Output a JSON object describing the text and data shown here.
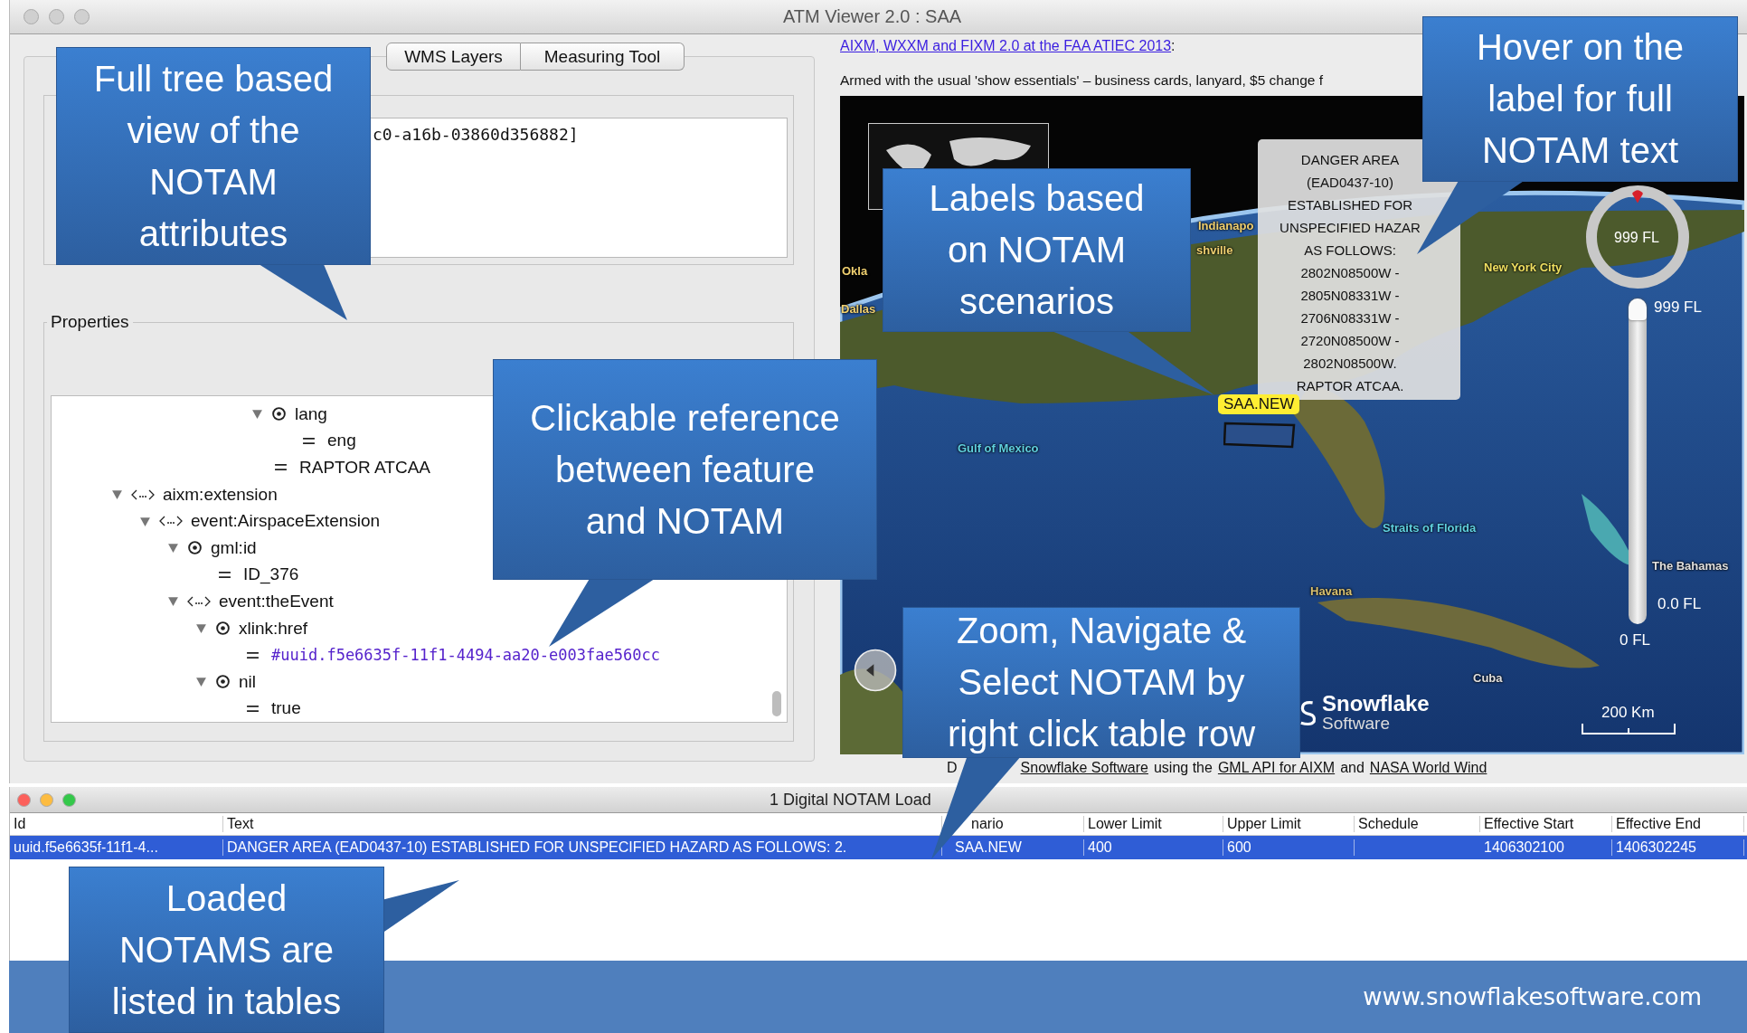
{
  "window": {
    "title": "ATM Viewer 2.0 : SAA",
    "active": false
  },
  "tabs": [
    {
      "label": "WMS Layers",
      "selected": false
    },
    {
      "label": "Measuring Tool",
      "selected": false
    }
  ],
  "identifier_field": {
    "value": "c0-a16b-03860d356882]"
  },
  "properties": {
    "title": "Properties"
  },
  "tree": [
    {
      "children": [
        {
          "children": [
            {
              "children": [
                {
                  "children": [
                    {
                      "children": [
                        {
                          "kind": "attribute",
                          "label": "lang",
                          "expanded": true,
                          "children": [
                            {
                              "kind": "value",
                              "label": "eng"
                            }
                          ]
                        },
                        {
                          "kind": "value",
                          "label": "RAPTOR ATCAA"
                        }
                      ]
                    }
                  ]
                }
              ]
            }
          ]
        }
      ]
    },
    {
      "kind": "element",
      "label": "aixm:extension",
      "expanded": true,
      "children": [
        {
          "kind": "element",
          "label": "event:AirspaceExtension",
          "expanded": true,
          "children": [
            {
              "kind": "attribute",
              "label": "gml:id",
              "expanded": true,
              "children": [
                {
                  "kind": "value",
                  "label": "ID_376"
                }
              ]
            },
            {
              "kind": "element",
              "label": "event:theEvent",
              "expanded": true,
              "children": [
                {
                  "kind": "attribute",
                  "label": "xlink:href",
                  "expanded": true,
                  "children": [
                    {
                      "kind": "link",
                      "label": "#uuid.f5e6635f-11f1-4494-aa20-e003fae560cc"
                    }
                  ]
                },
                {
                  "kind": "attribute",
                  "label": "nil",
                  "expanded": true,
                  "children": [
                    {
                      "kind": "value",
                      "label": "true"
                    }
                  ]
                }
              ]
            }
          ]
        }
      ]
    }
  ],
  "article": {
    "link": "AIXM, WXXM and FIXM 2.0 at the FAA ATIEC 2013",
    "link_suffix": ":",
    "intro": "Armed with the usual 'show essentials' – business cards, lanyard, $5 change f"
  },
  "map": {
    "place_labels": [
      "Indianapo",
      "shville",
      "Okla",
      "Dallas",
      "New York City",
      "Gulf of Mexico",
      "Straits of Florida",
      "Havana",
      "Cuba",
      "The Bahamas"
    ],
    "tooltip_lines": [
      "DANGER AREA",
      "(EAD0437-10)",
      "ESTABLISHED FOR",
      "UNSPECIFIED HAZAR",
      "AS FOLLOWS:",
      "2802N08500W -",
      "2805N08331W -",
      "2706N08331W -",
      "2720N08500W -",
      "2802N08500W.",
      "RAPTOR ATCAA."
    ],
    "feature_label": "SAA.NEW",
    "compass_reading": "999 FL",
    "altitude_slider": {
      "level": 1,
      "top_reading": "999 FL",
      "bottom_reading": "0.0 FL",
      "min_label": "0 FL"
    },
    "scale": "200 Km",
    "logo": {
      "name": "Snowflake",
      "sub": "Software"
    }
  },
  "caption": [
    {
      "kind": "text",
      "text": "D"
    },
    {
      "kind": "link",
      "text": "Snowflake Software"
    },
    {
      "kind": "text",
      "text": "using the"
    },
    {
      "kind": "link",
      "text": "GML API for AIXM"
    },
    {
      "kind": "text",
      "text": "and"
    },
    {
      "kind": "link",
      "text": "NASA World Wind"
    }
  ],
  "notam_window": {
    "title": "1 Digital NOTAM Load",
    "active": true
  },
  "table": {
    "columns": [
      "Id",
      "Text",
      "nario",
      "Lower Limit",
      "Upper Limit",
      "Schedule",
      "Effective Start",
      "Effective End"
    ],
    "rows": [
      {
        "selected": true,
        "cells": [
          "uuid.f5e6635f-11f1-4...",
          "DANGER AREA (EAD0437-10) ESTABLISHED FOR UNSPECIFIED HAZARD AS FOLLOWS: 2.",
          "SAA.NEW",
          "400",
          "600",
          null,
          "1406302100",
          "1406302245"
        ]
      }
    ]
  },
  "footer": {
    "url": "www.snowflakesoftware.com"
  },
  "callouts": [
    {
      "text": "Full tree based\nview of the\nNOTAM\nattributes"
    },
    {
      "text": "Hover on the\nlabel for full\nNOTAM text"
    },
    {
      "text": "Labels based\non NOTAM\nscenarios"
    },
    {
      "text": "Clickable reference\nbetween feature\nand NOTAM"
    },
    {
      "text": "Zoom, Navigate &\nSelect NOTAM by\nright click table row"
    },
    {
      "text": "Loaded\nNOTAMS are\nlisted in tables"
    }
  ]
}
